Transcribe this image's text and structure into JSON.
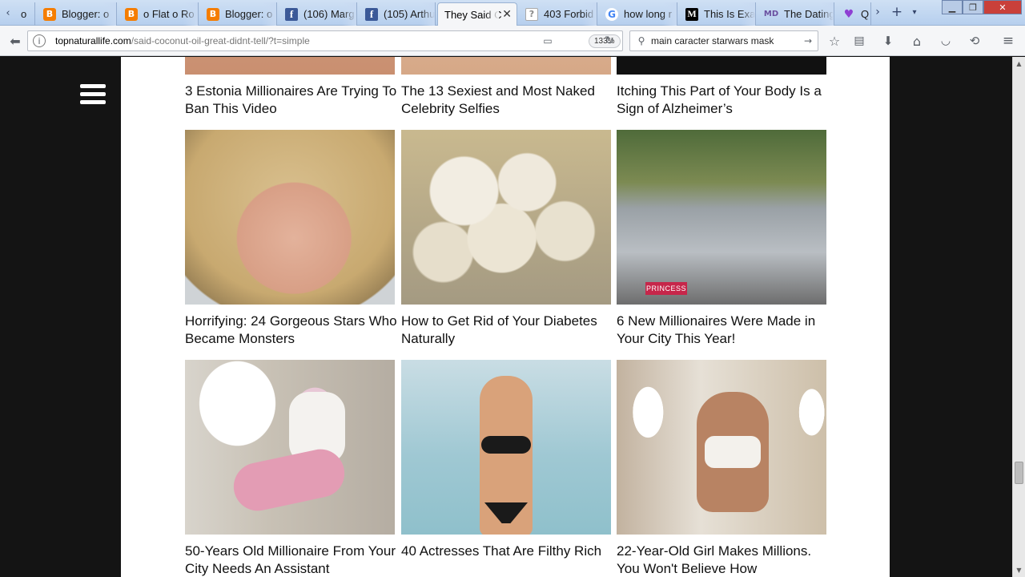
{
  "tabs": [
    {
      "favicon": "unknown-favicon",
      "title": "o"
    },
    {
      "favicon": "blogger-icon",
      "title": "Blogger: o"
    },
    {
      "favicon": "blogger-icon",
      "title": "o Flat o Ro"
    },
    {
      "favicon": "blogger-icon",
      "title": "Blogger: o"
    },
    {
      "favicon": "facebook-icon",
      "title": "(106) Marg"
    },
    {
      "favicon": "facebook-icon",
      "title": "(105) Arthu"
    },
    {
      "favicon": "none",
      "title": "They Said C",
      "active": true
    },
    {
      "favicon": "question-icon",
      "title": "403 Forbid"
    },
    {
      "favicon": "google-icon",
      "title": "how long r"
    },
    {
      "favicon": "medium-icon",
      "title": "This Is Exac"
    },
    {
      "favicon": "md-icon",
      "title": "The Dating"
    },
    {
      "favicon": "heart-icon",
      "title": "Q"
    }
  ],
  "navbar": {
    "url_host": "topnaturallife.com",
    "url_path": "/said-coconut-oil-great-didnt-tell/?t=simple",
    "zoom": "133%",
    "search_value": "main caracter starwars mask"
  },
  "cards": [
    {
      "caption": "3 Estonia Millionaires Are Trying To Ban This Video"
    },
    {
      "caption": "The 13 Sexiest and Most Naked Celebrity Selfies"
    },
    {
      "caption": "Itching This Part of Your Body Is a Sign of Alzheimer’s"
    },
    {
      "caption": "Horrifying: 24 Gorgeous Stars Who Became Monsters"
    },
    {
      "caption": "How to Get Rid of Your Diabetes Naturally"
    },
    {
      "caption": "6 New Millionaires Were Made in Your City This Year!",
      "plate": "PRINCESS"
    },
    {
      "caption": "50-Years Old Millionaire From Your City Needs An Assistant"
    },
    {
      "caption": "40 Actresses That Are Filthy Rich"
    },
    {
      "caption": "22-Year-Old Girl Makes Millions. You Won't Believe How"
    }
  ]
}
